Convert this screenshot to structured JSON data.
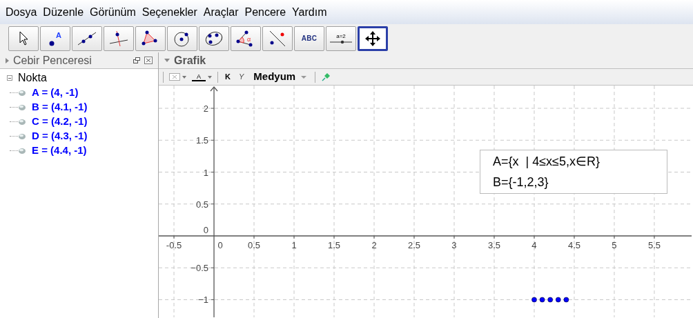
{
  "menu": [
    "Dosya",
    "Düzenle",
    "Görünüm",
    "Seçenekler",
    "Araçlar",
    "Pencere",
    "Yardım"
  ],
  "toolbar": [
    {
      "kind": "move",
      "selected": false
    },
    {
      "kind": "point",
      "label": "A",
      "selected": false
    },
    {
      "kind": "line",
      "selected": false
    },
    {
      "kind": "perpendicular",
      "selected": false
    },
    {
      "kind": "polygon",
      "selected": false
    },
    {
      "kind": "circle",
      "selected": false
    },
    {
      "kind": "conic",
      "selected": false
    },
    {
      "kind": "angle",
      "label": "α",
      "selected": false
    },
    {
      "kind": "reflect",
      "selected": false
    },
    {
      "kind": "text",
      "label": "ABC",
      "selected": false
    },
    {
      "kind": "slider",
      "label": "a=2",
      "selected": false
    },
    {
      "kind": "pan",
      "selected": true
    }
  ],
  "algebra": {
    "title": "Cebir Penceresi",
    "groups": [
      {
        "label": "Nokta",
        "expanded": true,
        "children": [
          {
            "text": "A = (4, -1)",
            "color": "#0000ff"
          },
          {
            "text": "B = (4.1, -1)",
            "color": "#0000ff"
          },
          {
            "text": "C = (4.2, -1)",
            "color": "#0000ff"
          },
          {
            "text": "D = (4.3, -1)",
            "color": "#0000ff"
          },
          {
            "text": "E = (4.4, -1)",
            "color": "#0000ff"
          }
        ]
      }
    ]
  },
  "graphics": {
    "title": "Grafik",
    "style_bar": {
      "color_label": "A",
      "bold": "K",
      "italic": "Y",
      "size": "Medyum"
    },
    "text_box": [
      "A={x  | 4≤x≤5,x∈R}",
      "B={-1,2,3}"
    ],
    "chart_data": {
      "type": "scatter",
      "x": [
        4,
        4.1,
        4.2,
        4.3,
        4.4
      ],
      "series": [
        {
          "color": "#0000ff",
          "values": [
            -1,
            -1,
            -1,
            -1,
            -1
          ]
        }
      ],
      "grid": true,
      "xlim": [
        -0.69,
        5.966
      ],
      "ylim": [
        -1.276,
        2.357
      ],
      "xticks": [
        -0.5,
        0.5,
        1,
        1.5,
        2,
        2.5,
        3,
        3.5,
        4,
        4.5,
        5,
        5.5
      ],
      "yticks": [
        2,
        1.5,
        1,
        0.5,
        {
          "value": -0.5,
          "label": "−0.5"
        },
        {
          "value": -1,
          "label": "−1"
        }
      ]
    },
    "x_origin_label": "0",
    "y_origin_label": "0"
  }
}
